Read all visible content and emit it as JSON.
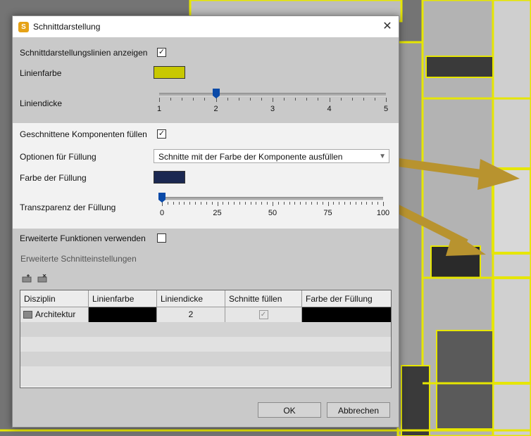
{
  "colors": {
    "line_color": "#c8c800",
    "fill_color": "#1b2851",
    "arrow": "#b8932f",
    "accent": "#0a4aa8"
  },
  "dialog": {
    "title": "Schnittdarstellung",
    "app_icon_letter": "S",
    "close_icon": "close-icon",
    "show_lines_label": "Schnittdarstellungslinien anzeigen",
    "show_lines_checked": true,
    "line_color_label": "Linienfarbe",
    "line_width_label": "Liniendicke",
    "line_width": {
      "value": 2,
      "min": 1,
      "max": 5,
      "ticks": [
        "1",
        "2",
        "3",
        "4",
        "5"
      ]
    },
    "fill_components_label": "Geschnittene Komponenten füllen",
    "fill_components_checked": true,
    "fill_options_label": "Optionen für Füllung",
    "fill_options_value": "Schnitte mit der Farbe der Komponente ausfüllen",
    "fill_color_label": "Farbe der Füllung",
    "transparency_label": "Transzparenz der Füllung",
    "transparency": {
      "value": 0,
      "min": 0,
      "max": 100,
      "ticks": [
        "0",
        "25",
        "50",
        "75",
        "100"
      ]
    },
    "advanced_label": "Erweiterte Funktionen verwenden",
    "advanced_checked": false,
    "advanced_section_title": "Erweiterte Schnitteinstellungen",
    "toolbar_icons": [
      "add-discipline-icon",
      "remove-discipline-icon"
    ],
    "table": {
      "columns": [
        "Disziplin",
        "Linienfarbe",
        "Liniendicke",
        "Schnitte füllen",
        "Farbe der Füllung"
      ],
      "rows": [
        {
          "discipline": "Architektur",
          "line_color": "#000000",
          "line_width": "2",
          "fill_checked": true,
          "fill_color": "#000000"
        }
      ]
    },
    "ok_label": "OK",
    "cancel_label": "Abbrechen"
  }
}
